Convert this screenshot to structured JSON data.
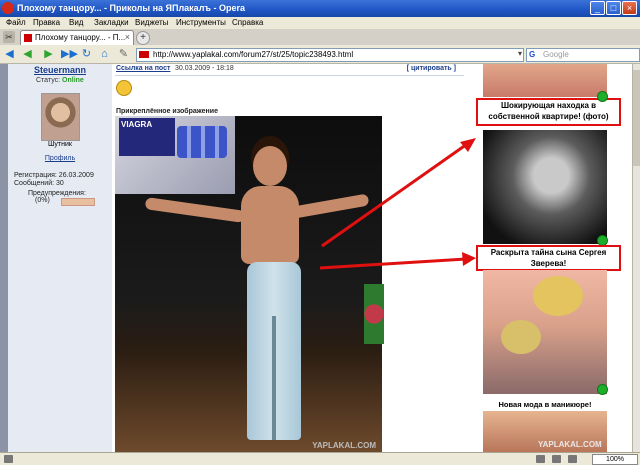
{
  "window": {
    "title": "Плохому танцору... - Приколы на ЯПлакалъ - Opera"
  },
  "menu": [
    "Файл",
    "Правка",
    "Вид",
    "Закладки",
    "Виджеты",
    "Инструменты",
    "Справка"
  ],
  "tabs": [
    {
      "label": "Плохому танцору... - П..."
    }
  ],
  "address": {
    "url": "http://www.yaplakal.com/forum27/st/25/topic238493.html",
    "search_placeholder": "Google"
  },
  "user": {
    "name": "Steuermann",
    "status_label": "Статус:",
    "status_value": "Online",
    "rank": "Шутник",
    "profile_link": "Профиль",
    "registration": "Регистрация: 26.03.2009",
    "messages": "Сообщений: 30",
    "warnings_label": "Предупреждения:",
    "warnings_value": "(0%)"
  },
  "post": {
    "link_label": "Ссылка на пост",
    "date": "30.03.2009 - 18:18",
    "quote_label": "[ цитировать ]",
    "attachment_label": "Прикреплённое изображение",
    "photo_pack_text": "VIAGRA",
    "photo_watermark": "YAPLAKAL.COM"
  },
  "ads": [
    {
      "caption": "Шокирующая находка в собственной квартире! (фото)"
    },
    {
      "caption": "Раскрыта тайна сына Сергея Зверева!"
    },
    {
      "caption": "Новая мода в маникюре!"
    }
  ],
  "right_watermark": "YAPLAKAL.COM",
  "statusbar": {
    "zoom": "100%"
  },
  "colors": {
    "titlebar": "#1f55c4",
    "highlight_red": "#e01010",
    "online_green": "#2a9b2a",
    "link_blue": "#1b3e8a",
    "page_bg": "#8b93a5"
  }
}
